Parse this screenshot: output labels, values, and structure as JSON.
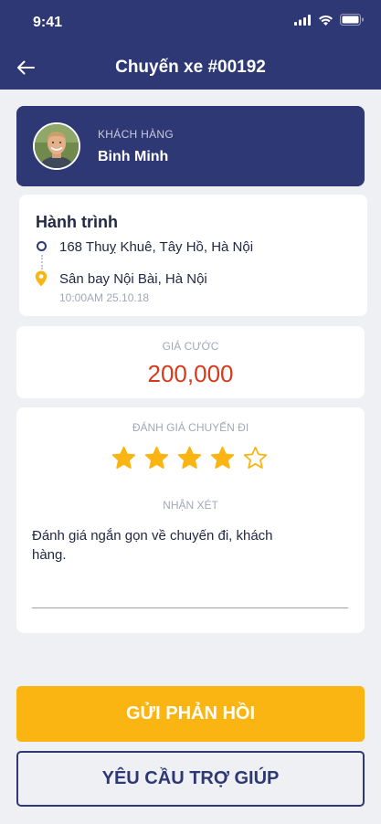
{
  "status_bar": {
    "time": "9:41"
  },
  "header": {
    "title": "Chuyến xe #00192"
  },
  "customer": {
    "label": "KHÁCH HÀNG",
    "name": "Binh Minh"
  },
  "route": {
    "title": "Hành trình",
    "origin": "168 Thuỵ Khuê, Tây Hồ, Hà Nội",
    "destination": "Sân bay Nội Bài, Hà Nội",
    "datetime": "10:00AM 25.10.18"
  },
  "fare": {
    "label": "GIÁ CƯỚC",
    "value": "200,000"
  },
  "rating": {
    "label": "ĐÁNH GIÁ CHUYẾN ĐI",
    "stars": 4,
    "max_stars": 5,
    "comment_label": "NHẬN XÉT",
    "comment_text": "Đánh giá ngắn gọn về chuyến đi, khách hàng."
  },
  "actions": {
    "submit_label": "GỬI PHẢN HỒI",
    "help_label": "YÊU CẦU TRỢ GIÚP"
  },
  "colors": {
    "primary": "#2e3874",
    "accent": "#fbb512",
    "price": "#d63a1c",
    "background": "#eff0f4"
  },
  "icons": [
    "back-arrow-icon",
    "signal-icon",
    "wifi-icon",
    "battery-icon",
    "origin-dot-icon",
    "location-pin-icon",
    "star-icon"
  ]
}
